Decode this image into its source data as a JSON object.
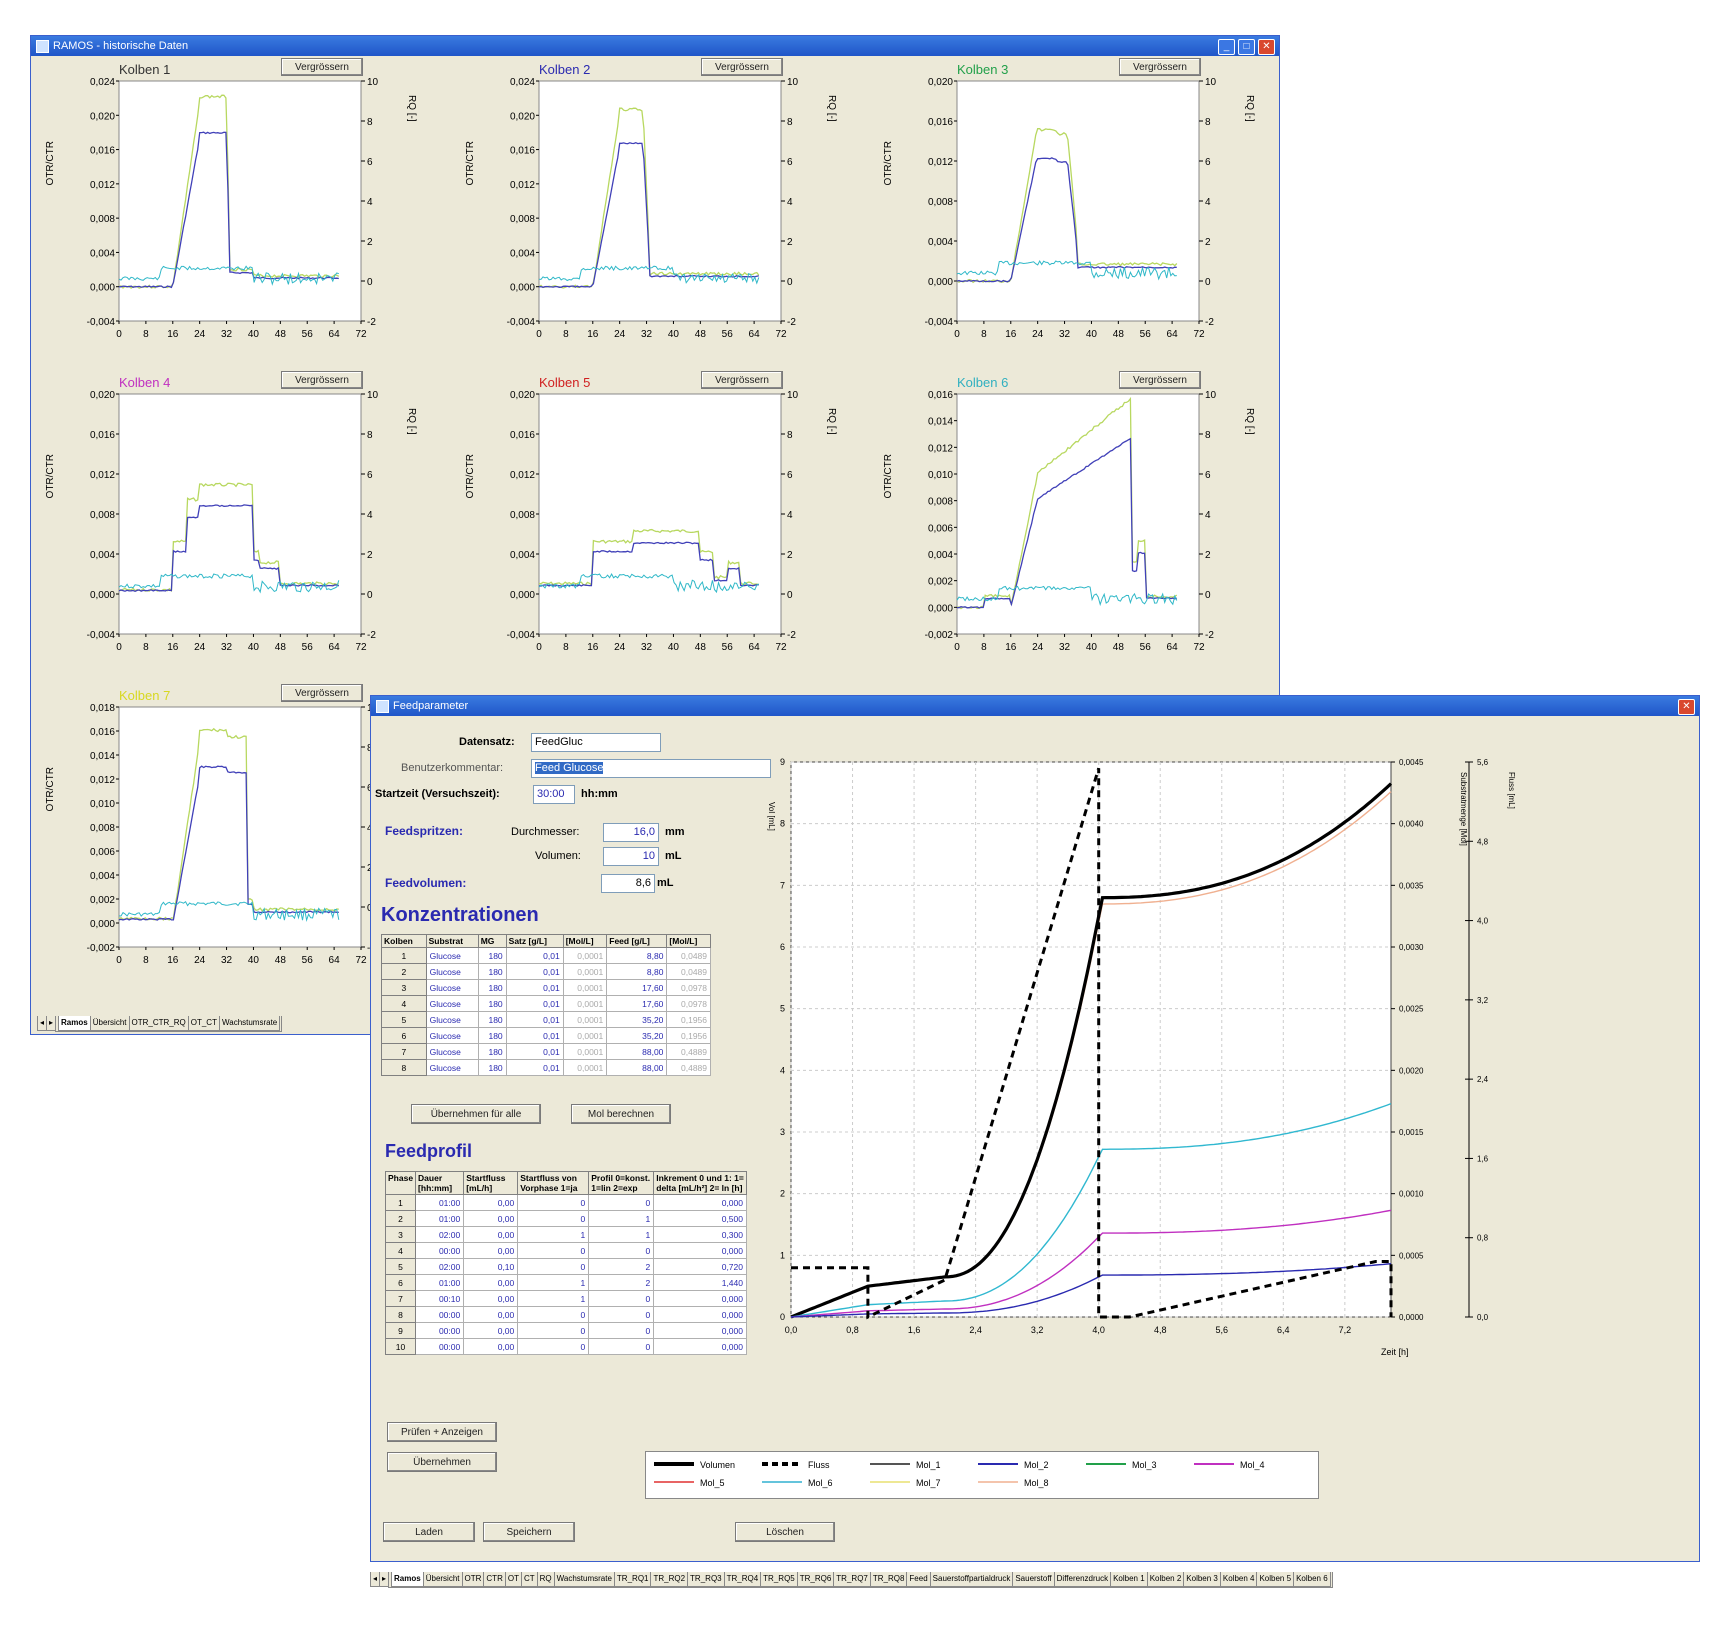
{
  "main_window": {
    "title": "RAMOS - historische Daten",
    "enlarge_label": "Vergrössern",
    "y_left_label": "OTR/CTR",
    "y_right_label": "RQ [-]",
    "x_ticks": [
      "0",
      "8",
      "16",
      "24",
      "32",
      "40",
      "48",
      "56",
      "64",
      "72"
    ],
    "right_ticks": [
      "10",
      "8",
      "6",
      "4",
      "2",
      "0",
      "-2"
    ],
    "panels": [
      {
        "title": "Kolben 1",
        "color": "#333333",
        "ticks": [
          "0,024",
          "0,020",
          "0,016",
          "0,012",
          "0,008",
          "0,004",
          "0,000",
          "-0,004"
        ]
      },
      {
        "title": "Kolben 2",
        "color": "#2a2ab0",
        "ticks": [
          "0,024",
          "0,020",
          "0,016",
          "0,012",
          "0,008",
          "0,004",
          "0,000",
          "-0,004"
        ]
      },
      {
        "title": "Kolben 3",
        "color": "#22a04a",
        "ticks": [
          "0,020",
          "0,016",
          "0,012",
          "0,008",
          "0,004",
          "0,000",
          "-0,004"
        ]
      },
      {
        "title": "Kolben 4",
        "color": "#c030c0",
        "ticks": [
          "0,020",
          "0,016",
          "0,012",
          "0,008",
          "0,004",
          "0,000",
          "-0,004"
        ]
      },
      {
        "title": "Kolben 5",
        "color": "#d02020",
        "ticks": [
          "0,020",
          "0,016",
          "0,012",
          "0,008",
          "0,004",
          "0,000",
          "-0,004"
        ]
      },
      {
        "title": "Kolben 6",
        "color": "#30b0c0",
        "ticks": [
          "0,016",
          "0,014",
          "0,012",
          "0,010",
          "0,008",
          "0,006",
          "0,004",
          "0,002",
          "0,000",
          "-0,002"
        ]
      },
      {
        "title": "Kolben 7",
        "color": "#d8d820",
        "ticks": [
          "0,018",
          "0,016",
          "0,014",
          "0,012",
          "0,010",
          "0,008",
          "0,006",
          "0,004",
          "0,002",
          "0,000",
          "-0,002"
        ]
      }
    ],
    "tabs": [
      "Ramos",
      "Übersicht",
      "OTR_CTR_RQ",
      "OT_CT",
      "Wachstumsrate"
    ]
  },
  "feed_window": {
    "title": "Feedparameter",
    "datensatz_label": "Datensatz:",
    "datensatz_value": "FeedGluc",
    "kommentar_label": "Benutzerkommentar:",
    "kommentar_value": "Feed Glucose",
    "startzeit_label": "Startzeit (Versuchszeit):",
    "startzeit_value": "30:00",
    "startzeit_unit": "hh:mm",
    "feedspritzen_label": "Feedspritzen:",
    "durchmesser_label": "Durchmesser:",
    "durchmesser_value": "16,0",
    "durchmesser_unit": "mm",
    "volumen_label": "Volumen:",
    "volumen_value": "10",
    "volumen_unit": "mL",
    "feedvolumen_label": "Feedvolumen:",
    "feedvolumen_value": "8,6",
    "feedvolumen_unit": "mL",
    "konz_heading": "Konzentrationen",
    "konz_headers": [
      "Kolben",
      "Substrat",
      "MG",
      "Satz [g/L]",
      "[Mol/L]",
      "Feed [g/L]",
      "[Mol/L]"
    ],
    "konz_rows": [
      [
        "1",
        "Glucose",
        "180",
        "0,01",
        "0,0001",
        "8,80",
        "0,0489"
      ],
      [
        "2",
        "Glucose",
        "180",
        "0,01",
        "0,0001",
        "8,80",
        "0,0489"
      ],
      [
        "3",
        "Glucose",
        "180",
        "0,01",
        "0,0001",
        "17,60",
        "0,0978"
      ],
      [
        "4",
        "Glucose",
        "180",
        "0,01",
        "0,0001",
        "17,60",
        "0,0978"
      ],
      [
        "5",
        "Glucose",
        "180",
        "0,01",
        "0,0001",
        "35,20",
        "0,1956"
      ],
      [
        "6",
        "Glucose",
        "180",
        "0,01",
        "0,0001",
        "35,20",
        "0,1956"
      ],
      [
        "7",
        "Glucose",
        "180",
        "0,01",
        "0,0001",
        "88,00",
        "0,4889"
      ],
      [
        "8",
        "Glucose",
        "180",
        "0,01",
        "0,0001",
        "88,00",
        "0,4889"
      ]
    ],
    "btn_uebernehmen_alle": "Übernehmen für alle",
    "btn_mol": "Mol berechnen",
    "profil_heading": "Feedprofil",
    "profil_headers": [
      "Phase",
      "Dauer [hh:mm]",
      "Startfluss [mL/h]",
      "Startfluss von Vorphase 1=ja",
      "Profil 0=konst. 1=lin 2=exp",
      "Inkrement 0 und 1: 1= delta [mL/h²] 2= ln [h]"
    ],
    "profil_rows": [
      [
        "1",
        "01:00",
        "0,00",
        "0",
        "0",
        "0,000"
      ],
      [
        "2",
        "01:00",
        "0,00",
        "0",
        "1",
        "0,500"
      ],
      [
        "3",
        "02:00",
        "0,00",
        "1",
        "1",
        "0,300"
      ],
      [
        "4",
        "00:00",
        "0,00",
        "0",
        "0",
        "0,000"
      ],
      [
        "5",
        "02:00",
        "0,10",
        "0",
        "2",
        "0,720"
      ],
      [
        "6",
        "01:00",
        "0,00",
        "1",
        "2",
        "1,440"
      ],
      [
        "7",
        "00:10",
        "0,00",
        "1",
        "0",
        "0,000"
      ],
      [
        "8",
        "00:00",
        "0,00",
        "0",
        "0",
        "0,000"
      ],
      [
        "9",
        "00:00",
        "0,00",
        "0",
        "0",
        "0,000"
      ],
      [
        "10",
        "00:00",
        "0,00",
        "0",
        "0",
        "0,000"
      ]
    ],
    "btn_pruefen": "Prüfen + Anzeigen",
    "btn_uebernehmen": "Übernehmen",
    "btn_laden": "Laden",
    "btn_speichern": "Speichern",
    "btn_loeschen": "Löschen",
    "chart": {
      "left_label": "Vol [mL]",
      "mid_label": "Substratmenge [Mol]",
      "right_label": "Fluss [mL]",
      "x_label": "Zeit [h]",
      "x_ticks": [
        "0,0",
        "0,8",
        "1,6",
        "2,4",
        "3,2",
        "4,0",
        "4,8",
        "5,6",
        "6,4",
        "7,2"
      ],
      "left_ticks": [
        "0",
        "1",
        "2",
        "3",
        "4",
        "5",
        "6",
        "7",
        "8",
        "9"
      ],
      "mid_ticks": [
        "0,0000",
        "0,0005",
        "0,0010",
        "0,0015",
        "0,0020",
        "0,0025",
        "0,0030",
        "0,0035",
        "0,0040",
        "0,0045"
      ],
      "right_ticks": [
        "0,0",
        "0,8",
        "1,6",
        "2,4",
        "3,2",
        "4,0",
        "4,8",
        "5,6"
      ]
    },
    "legend": [
      {
        "name": "Volumen",
        "color": "#000000",
        "dash": "",
        "w": 4
      },
      {
        "name": "Fluss",
        "color": "#000000",
        "dash": "6,4",
        "w": 4
      },
      {
        "name": "Mol_1",
        "color": "#555555",
        "dash": "",
        "w": 2
      },
      {
        "name": "Mol_2",
        "color": "#2a2ab0",
        "dash": "",
        "w": 2
      },
      {
        "name": "Mol_3",
        "color": "#22a04a",
        "dash": "",
        "w": 2
      },
      {
        "name": "Mol_4",
        "color": "#c030c0",
        "dash": "",
        "w": 2
      },
      {
        "name": "Mol_5",
        "color": "#e03030",
        "dash": "",
        "w": 1.5
      },
      {
        "name": "Mol_6",
        "color": "#30b0d0",
        "dash": "",
        "w": 1.5
      },
      {
        "name": "Mol_7",
        "color": "#e8e070",
        "dash": "",
        "w": 1.5
      },
      {
        "name": "Mol_8",
        "color": "#f0b090",
        "dash": "",
        "w": 1.5
      }
    ]
  },
  "bottom_tabs": [
    "Ramos",
    "Übersicht",
    "OTR",
    "CTR",
    "OT",
    "CT",
    "RQ",
    "Wachstumsrate",
    "TR_RQ1",
    "TR_RQ2",
    "TR_RQ3",
    "TR_RQ4",
    "TR_RQ5",
    "TR_RQ6",
    "TR_RQ7",
    "TR_RQ8",
    "Feed",
    "Sauerstoffpartialdruck",
    "Sauerstoff",
    "Differenzdruck",
    "Kolben 1",
    "Kolben 2",
    "Kolben 3",
    "Kolben 4",
    "Kolben 5",
    "Kolben 6"
  ]
}
